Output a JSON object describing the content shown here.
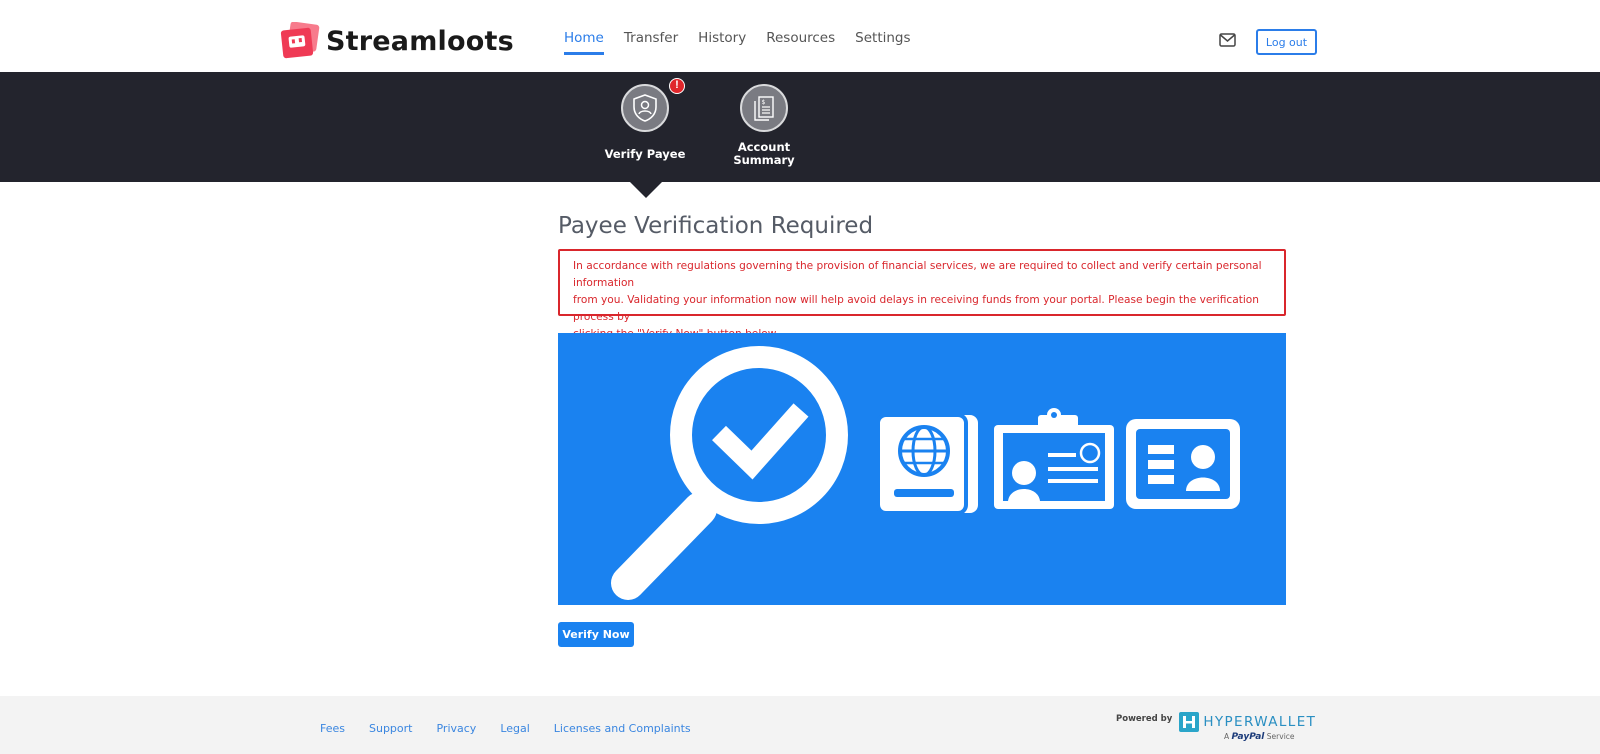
{
  "app": {
    "brand": "Streamloots"
  },
  "nav": {
    "items": [
      {
        "label": "Home",
        "active": true
      },
      {
        "label": "Transfer",
        "active": false
      },
      {
        "label": "History",
        "active": false
      },
      {
        "label": "Resources",
        "active": false
      },
      {
        "label": "Settings",
        "active": false
      }
    ]
  },
  "header": {
    "logout_label": "Log out",
    "mail_icon": "mail-icon"
  },
  "steps": [
    {
      "label": "Verify Payee",
      "icon": "shield-user-icon",
      "alert": "!"
    },
    {
      "label_line1": "Account",
      "label_line2": "Summary",
      "icon": "document-icon"
    }
  ],
  "main": {
    "title": "Payee Verification Required",
    "notice_line1": "In accordance with regulations governing the provision of financial services, we are required to collect and verify certain personal information",
    "notice_line2": "from you. Validating your information now will help avoid delays in receiving funds from your portal. Please begin the verification process by",
    "notice_line3": "clicking the \"Verify Now\" button below.",
    "verify_button": "Verify Now"
  },
  "footer": {
    "links": [
      "Fees",
      "Support",
      "Privacy",
      "Legal",
      "Licenses and Complaints"
    ],
    "powered_by": "Powered by",
    "provider": "HYPERWALLET",
    "paypal_prefix": "A",
    "paypal_brand": "PayPal",
    "paypal_suffix": "Service"
  },
  "colors": {
    "accent": "#2b7de9",
    "hero_blue": "#1a82f0",
    "alert_red": "#d9262c",
    "dark_bar": "#23242d",
    "brand_logo": "#ef3a55"
  }
}
